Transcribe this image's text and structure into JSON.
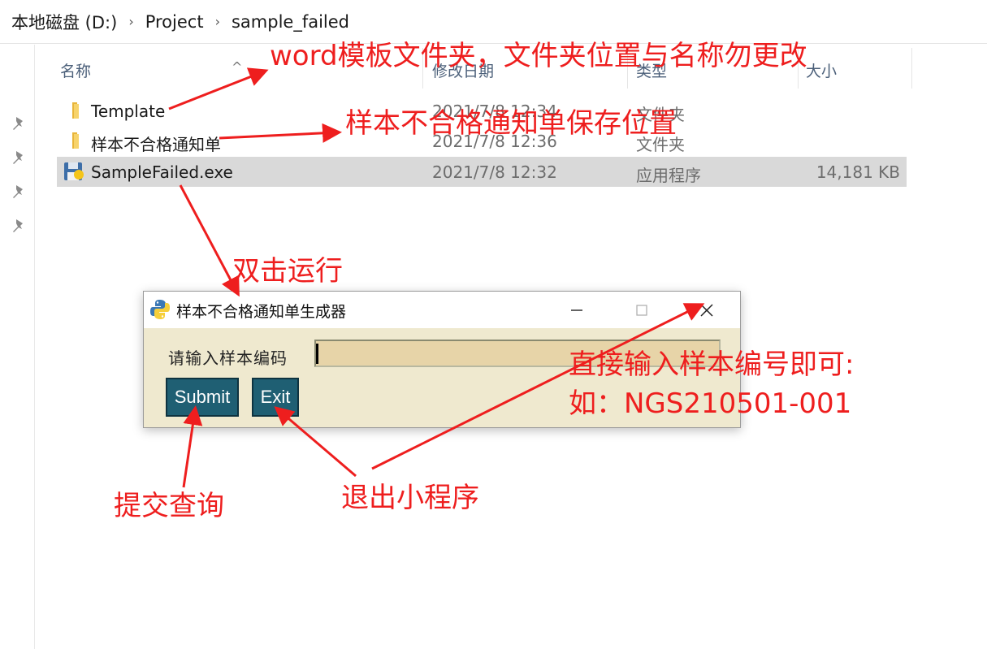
{
  "breadcrumb": {
    "items": [
      "本地磁盘 (D:)",
      "Project",
      "sample_failed"
    ],
    "separator": "›"
  },
  "columns": {
    "name": "名称",
    "date": "修改日期",
    "type": "类型",
    "size": "大小"
  },
  "files": [
    {
      "name": "Template",
      "date": "2021/7/8 12:34",
      "type": "文件夹",
      "size": "",
      "icon": "folder-icon"
    },
    {
      "name": "样本不合格通知单",
      "date": "2021/7/8 12:36",
      "type": "文件夹",
      "size": "",
      "icon": "folder-icon"
    },
    {
      "name": "SampleFailed.exe",
      "date": "2021/7/8 12:32",
      "type": "应用程序",
      "size": "14,181 KB",
      "icon": "python-exe-icon",
      "selected": true
    }
  ],
  "app_window": {
    "title": "样本不合格通知单生成器",
    "field_label": "请输入样本编码",
    "input_value": "",
    "submit_label": "Submit",
    "exit_label": "Exit",
    "minimize_glyph": "—",
    "maximize_glyph": "☐",
    "close_glyph": "✕"
  },
  "annotations": {
    "template_note": "word模板文件夹，文件夹位置与名称勿更改",
    "notice_folder_note": "样本不合格通知单保存位置",
    "run_note": "双击运行",
    "input_note_line1": "直接输入样本编号即可:",
    "input_note_line2": "如：NGS210501-001",
    "submit_note": "提交查询",
    "exit_note": "退出小程序"
  },
  "colors": {
    "annotation": "#ee1e1e",
    "button_bg": "#1f5f73",
    "window_bg": "#efe9cf",
    "input_bg": "#e7d4a8",
    "selected_row": "#d9d9d9"
  }
}
